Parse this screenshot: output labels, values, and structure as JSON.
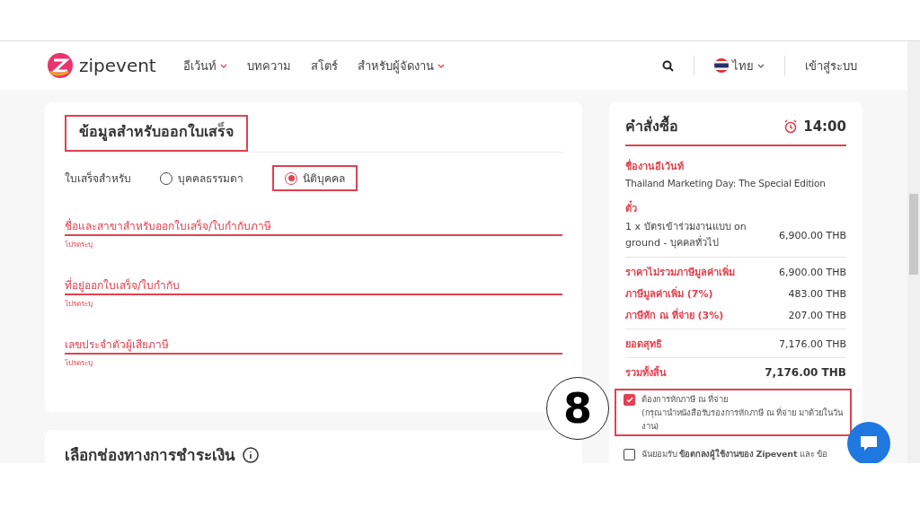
{
  "nav": {
    "logo": "zipevent",
    "menu": [
      {
        "label": "อีเว้นท์",
        "dropdown": true
      },
      {
        "label": "บทความ",
        "dropdown": false
      },
      {
        "label": "สโตร์",
        "dropdown": false
      },
      {
        "label": "สำหรับผู้จัดงาน",
        "dropdown": true
      }
    ],
    "language": "ไทย",
    "login": "เข้าสู่ระบบ"
  },
  "invoice": {
    "title": "ข้อมูลสำหรับออกใบเสร็จ",
    "for_label": "ใบเสร็จสำหรับ",
    "options": [
      {
        "label": "บุคคลธรรมดา",
        "selected": false
      },
      {
        "label": "นิติบุคคล",
        "selected": true
      }
    ],
    "fields": [
      {
        "placeholder": "ชื่อและสาขาสำหรับออกใบเสร็จ/ใบกำกับภาษี",
        "error": "โปรดระบุ"
      },
      {
        "placeholder": "ที่อยู่ออกใบเสร็จ/ใบกำกับ",
        "error": "โปรดระบุ"
      },
      {
        "placeholder": "เลขประจำตัวผู้เสียภาษี",
        "error": "โปรดระบุ"
      }
    ]
  },
  "payment": {
    "title": "เลือกช่องทางการชำระเงิน"
  },
  "order": {
    "title": "คำสั่งซื้อ",
    "timer": "14:00",
    "event_label": "ชื่องานอีเว้นท์",
    "event_name": "Thailand Marketing Day: The Special Edition",
    "ticket_label": "ตั๋ว",
    "ticket": "1 x บัตรเข้าร่วมงานแบบ on ground - บุคคลทั่วไป",
    "ticket_price": "6,900.00 THB",
    "lines": [
      {
        "label": "ราคาไม่รวมภาษีมูลค่าเพิ่ม",
        "value": "6,900.00 THB"
      },
      {
        "label": "ภาษีมูลค่าเพิ่ม (7%)",
        "value": "483.00 THB"
      },
      {
        "label": "ภาษีหัก ณ ที่จ่าย (3%)",
        "value": "207.00 THB"
      }
    ],
    "net_label": "ยอดสุทธิ",
    "net": "7,176.00 THB",
    "total_label": "รวมทั้งสิ้น",
    "total": "7,176.00 THB",
    "checks": [
      {
        "text": "ต้องการหักภาษี ณ ที่จ่าย",
        "note": "(กรุณานำหนังสือรับรองการหักภาษี ณ ที่จ่าย มาด้วยในวันงาน)",
        "checked": true,
        "highlighted": true
      },
      {
        "text": "ฉันยอมรับ **ข้อตกลงผู้ใช้งานของ Zipevent** และ ข้อ",
        "checked": false,
        "highlighted": false
      }
    ]
  },
  "annotation": "8"
}
